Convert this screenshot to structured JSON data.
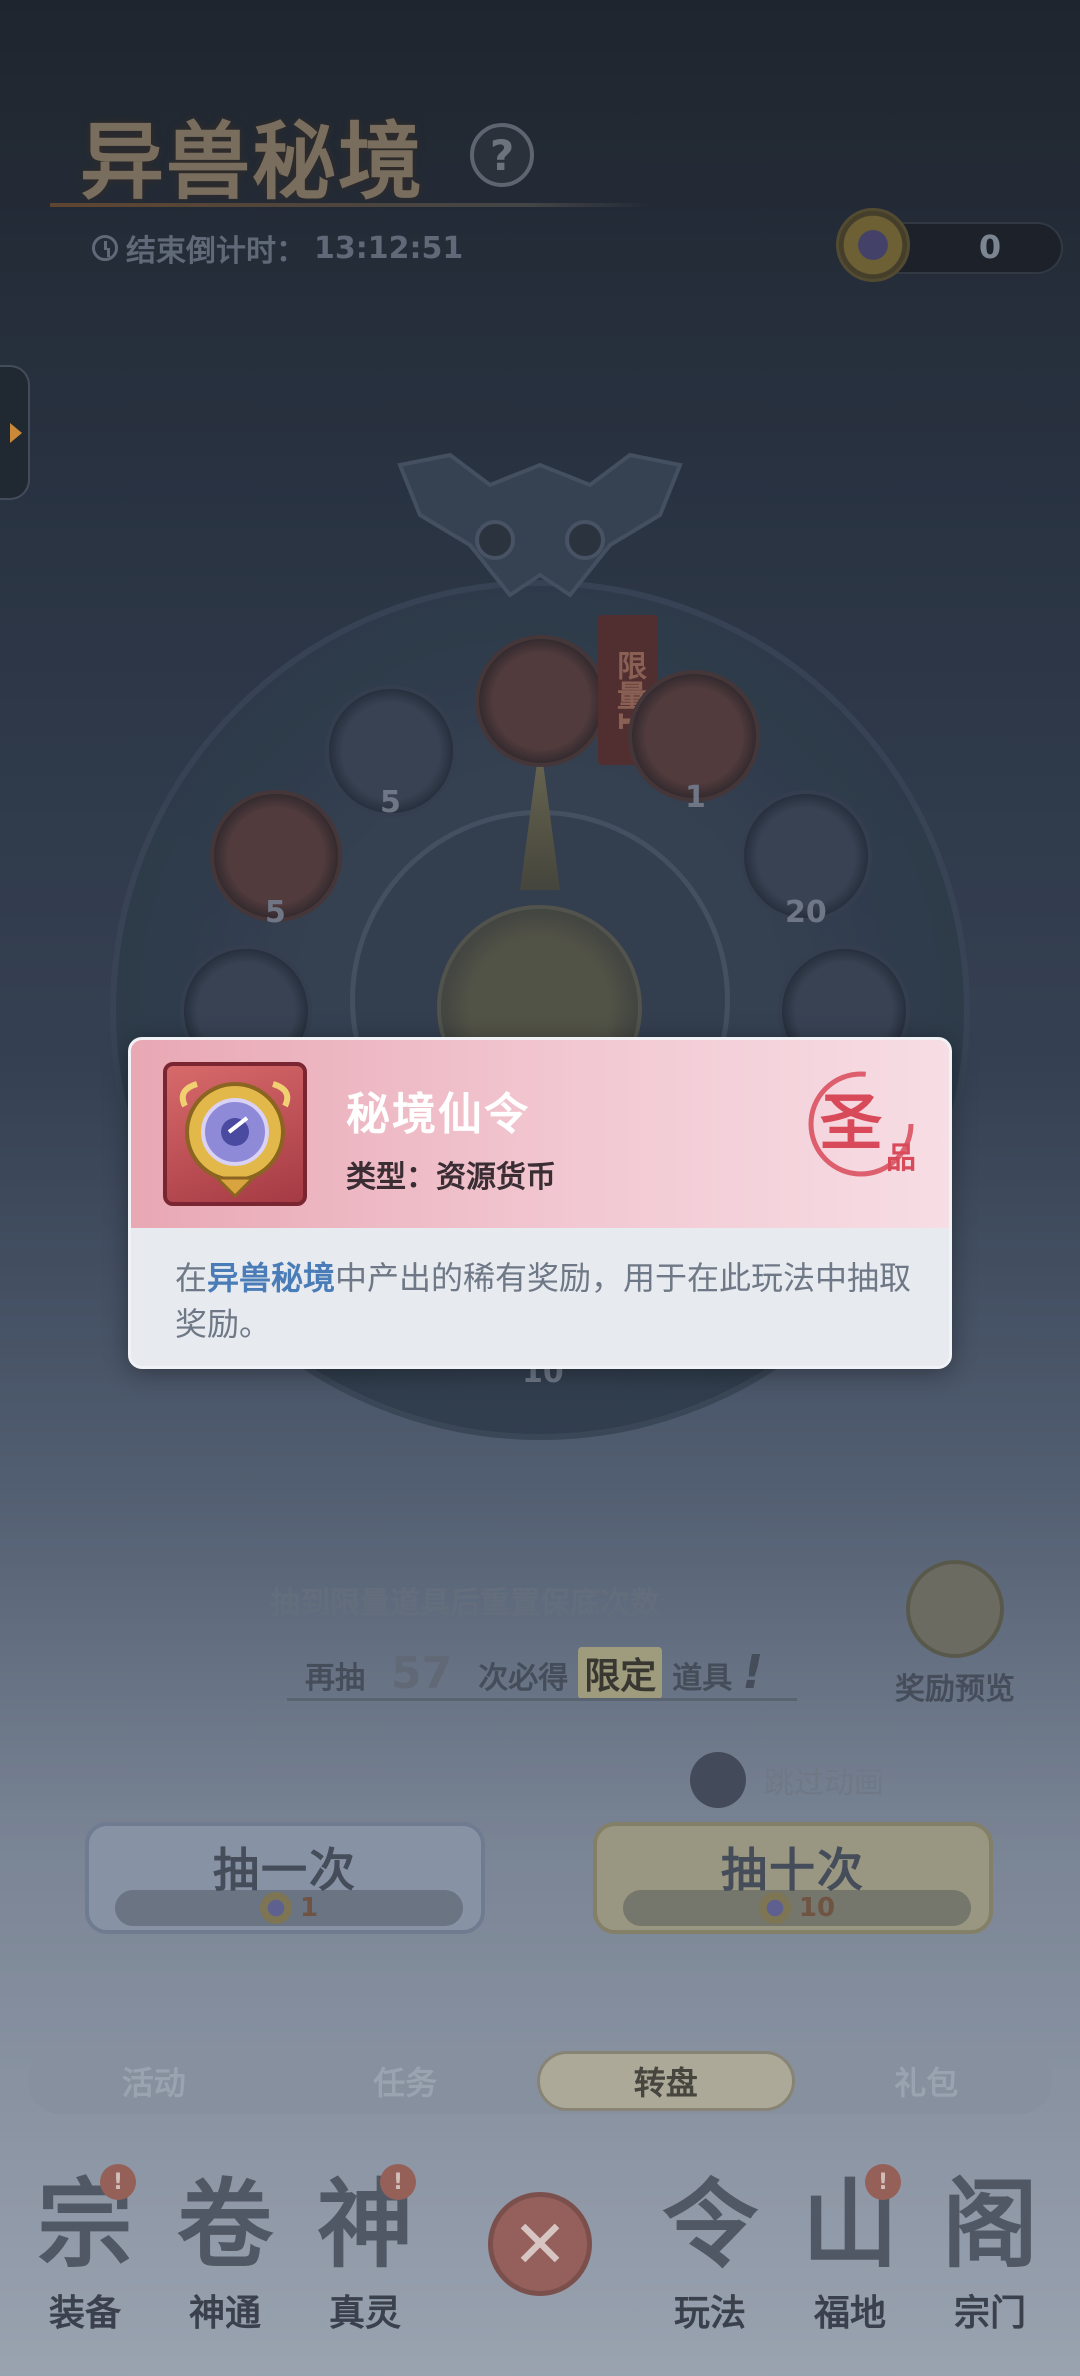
{
  "header": {
    "title": "异兽秘境",
    "help": "?",
    "countdown_label": "结束倒计时：",
    "countdown_value": "13:12:51",
    "currency_count": "0"
  },
  "wheel": {
    "limit_tag": "限量1",
    "slots": [
      {
        "count": "5"
      },
      {
        "count": "1"
      },
      {
        "count": "5"
      },
      {
        "count": "20"
      },
      {
        "count": "10"
      }
    ]
  },
  "guarantee": {
    "title": "抽到限量道具后重置保底次数",
    "prefix": "再抽",
    "count": "57",
    "middle": "次必得",
    "limited": "限定",
    "suffix": "道具",
    "exclaim": "!"
  },
  "reward_preview": {
    "label": "奖励预览"
  },
  "skip": {
    "label": "跳过动画"
  },
  "draw_one": {
    "label": "抽一次",
    "cost": "1"
  },
  "draw_ten": {
    "label": "抽十次",
    "cost": "10"
  },
  "tabs": [
    {
      "label": "活动"
    },
    {
      "label": "任务"
    },
    {
      "label": "转盘"
    },
    {
      "label": "礼包"
    }
  ],
  "nav": [
    {
      "label": "装备",
      "glyph": "宗",
      "badge": "!"
    },
    {
      "label": "神通",
      "glyph": "卷",
      "badge": ""
    },
    {
      "label": "真灵",
      "glyph": "神",
      "badge": "!"
    },
    {
      "label": "玩法",
      "glyph": "令",
      "badge": ""
    },
    {
      "label": "福地",
      "glyph": "山",
      "badge": "!"
    },
    {
      "label": "宗门",
      "glyph": "阁",
      "badge": ""
    }
  ],
  "nav_close": "✕",
  "popup": {
    "item_name": "秘境仙令",
    "type_label": "类型：",
    "type_value": "资源货币",
    "grade": "圣品",
    "desc_pre": "在",
    "desc_hl": "异兽秘境",
    "desc_post": "中产出的稀有奖励，用于在此玩法中抽取奖励。"
  },
  "colors": {
    "accent_pink": "#e8a8b4",
    "highlight_blue": "#4a7db7",
    "grade_red": "#d84a5a"
  },
  "icons": [
    "clock-icon",
    "help-icon",
    "currency-token-icon",
    "side-arrow-icon",
    "reward-gift-icon",
    "close-icon"
  ]
}
